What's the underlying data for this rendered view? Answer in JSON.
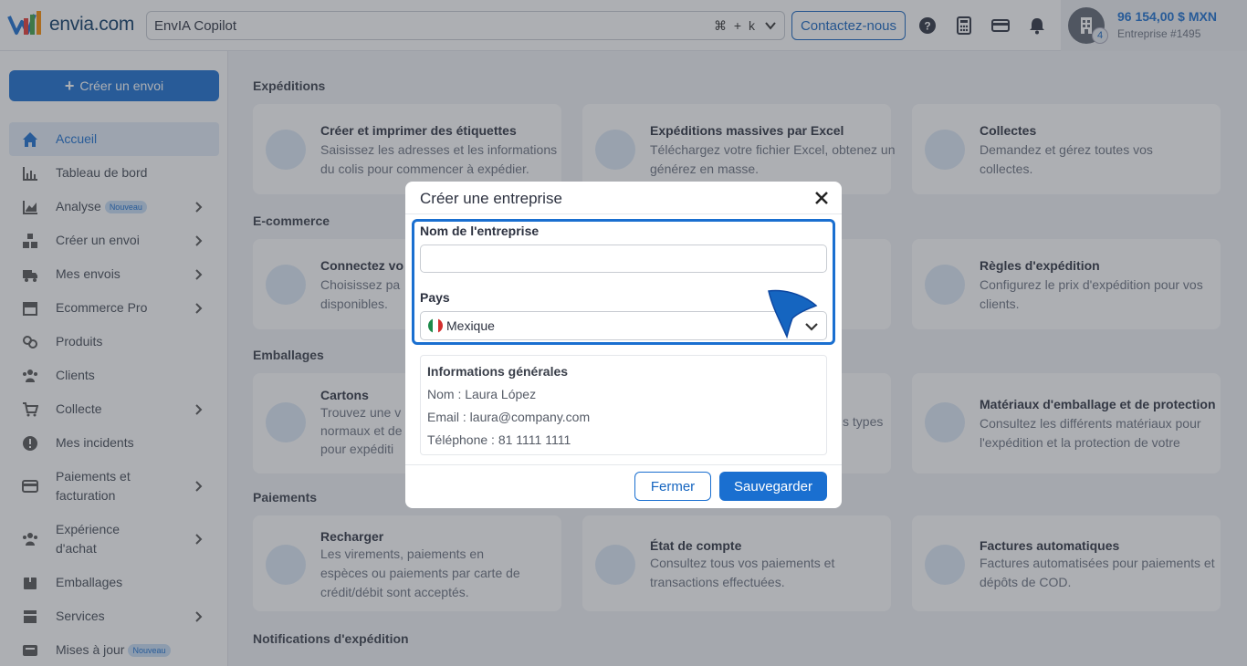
{
  "header": {
    "logo_text": "envia.com",
    "search_value": "EnvIA Copilot",
    "search_shortcut": "⌘ + k",
    "contact_label": "Contactez-nous",
    "account": {
      "balance": "96 154,00 $ MXN",
      "company": "Entreprise #1495",
      "badge_count": "4"
    }
  },
  "sidebar": {
    "create_label": "Créer un envoi",
    "items": [
      {
        "label": "Accueil",
        "icon": "home-icon",
        "active": true
      },
      {
        "label": "Tableau de bord",
        "icon": "bar-chart-icon"
      },
      {
        "label": "Analyse",
        "icon": "analytics-icon",
        "badge": "Nouveau",
        "arrow": true
      },
      {
        "label": "Créer un envoi",
        "icon": "boxes-icon",
        "arrow": true
      },
      {
        "label": "Mes envois",
        "icon": "truck-icon",
        "arrow": true
      },
      {
        "label": "Ecommerce Pro",
        "icon": "store-icon",
        "arrow": true
      },
      {
        "label": "Produits",
        "icon": "products-icon"
      },
      {
        "label": "Clients",
        "icon": "users-icon"
      },
      {
        "label": "Collecte",
        "icon": "cart-icon",
        "arrow": true
      },
      {
        "label": "Mes incidents",
        "icon": "alert-icon"
      },
      {
        "label": "Paiements et facturation",
        "icon": "card-icon",
        "arrow": true,
        "tall": true
      },
      {
        "label": "Expérience d'achat",
        "icon": "people-icon",
        "arrow": true,
        "tall": true
      },
      {
        "label": "Emballages",
        "icon": "package-icon"
      },
      {
        "label": "Services",
        "icon": "services-icon",
        "arrow": true
      },
      {
        "label": "Mises à jour",
        "icon": "updates-icon",
        "badge": "Nouveau"
      }
    ]
  },
  "main": {
    "sections": {
      "expeditions": "Expéditions",
      "ecommerce": "E-commerce",
      "emballages": "Emballages",
      "paiements": "Paiements",
      "notifications": "Notifications d'expédition"
    },
    "cards": {
      "labels": {
        "title": "Créer et imprimer des étiquettes",
        "l1": "Saisissez les adresses et les informations",
        "l2": "du colis pour commencer à expédier."
      },
      "excel": {
        "title": "Expéditions massives par Excel",
        "l1": "Téléchargez votre fichier Excel, obtenez un",
        "l2": "générez en masse."
      },
      "collectes": {
        "title": "Collectes",
        "l1": "Demandez et gérez toutes vos",
        "l2": "collectes."
      },
      "connectez": {
        "title": "Connectez vo",
        "l1": "Choisissez pa",
        "l2": "disponibles."
      },
      "commandes": {
        "l1": "mandes"
      },
      "regles": {
        "title": "Règles d'expédition",
        "l1": "Configurez le prix d'expédition pour vos",
        "l2": "clients."
      },
      "cartons": {
        "title": "Cartons",
        "l1": "Trouvez une v",
        "l2": "normaux et de",
        "l3": "pour expéditi"
      },
      "types": {
        "l1": "s types"
      },
      "materiaux": {
        "title": "Matériaux d'emballage et de protection",
        "l1": "Consultez les différents matériaux pour",
        "l2": "l'expédition et la protection de votre"
      },
      "recharger": {
        "title": "Recharger",
        "l1": "Les virements, paiements en",
        "l2": "espèces ou paiements par carte de",
        "l3": "crédit/débit sont acceptés."
      },
      "etat": {
        "title": "État de compte",
        "l1": "Consultez tous vos paiements et",
        "l2": "transactions effectuées."
      },
      "factures": {
        "title": "Factures automatiques",
        "l1": "Factures automatisées pour paiements et",
        "l2": "dépôts de COD."
      }
    }
  },
  "modal": {
    "title": "Créer une entreprise",
    "name_label": "Nom de l'entreprise",
    "name_value": "",
    "country_label": "Pays",
    "country_value": "Mexique",
    "info_title": "Informations générales",
    "info_name": "Nom : Laura López",
    "info_email": "Email : laura@company.com",
    "info_phone": "Téléphone : 81 1111 1111",
    "close_label": "Fermer",
    "save_label": "Sauvegarder"
  },
  "colors": {
    "primary": "#1a6fd0",
    "overlay": "rgba(60,65,75,0.42)"
  }
}
